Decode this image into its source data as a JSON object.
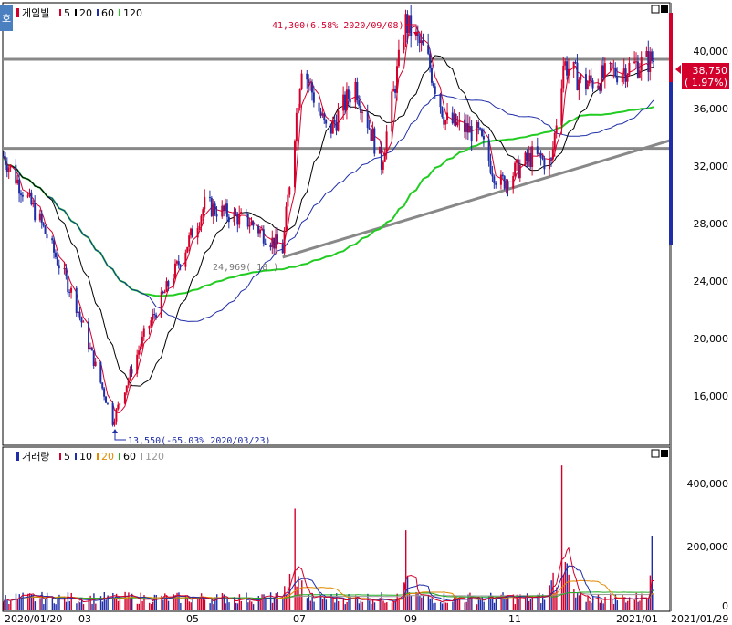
{
  "app": {
    "corner_label": "호",
    "window_buttons": [
      "□",
      "■"
    ]
  },
  "price_panel": {
    "title": "게임빌",
    "legend": [
      {
        "label": "5",
        "color": "#d4002c"
      },
      {
        "label": "20",
        "color": "#000000"
      },
      {
        "label": "60",
        "color": "#1f2ea8"
      },
      {
        "label": "120",
        "color": "#22cc22"
      }
    ],
    "y_ticks": [
      "40,000",
      "36,000",
      "32,000",
      "28,000",
      "24,000",
      "20,000",
      "16,000"
    ],
    "current_price": "38,750",
    "current_change": "( 1.97%)",
    "high_annotation": "41,300(6.58% 2020/09/08)",
    "low_annotation": "13,550(-65.03% 2020/03/23)",
    "mid_annotation": "24,969( 18 )"
  },
  "volume_panel": {
    "title": "거래량",
    "legend": [
      {
        "label": "5",
        "color": "#d4002c"
      },
      {
        "label": "10",
        "color": "#1f2ea8"
      },
      {
        "label": "20",
        "color": "#e08a00"
      },
      {
        "label": "60",
        "color": "#22aa22"
      },
      {
        "label": "120",
        "color": "#999999"
      }
    ],
    "y_ticks": [
      "400,000",
      "200,000",
      "0"
    ]
  },
  "x_axis": {
    "labels": [
      "2020/01/20",
      "03",
      "05",
      "07",
      "09",
      "11",
      "2021/01",
      "2021/01/29"
    ]
  },
  "chart_data": {
    "type": "candlestick",
    "title": "게임빌",
    "price_ylim": [
      12000,
      42500
    ],
    "volume_ylim": [
      0,
      500000
    ],
    "key_points": [
      {
        "date": "2020/01/20",
        "close": 32000
      },
      {
        "date": "2020/02/10",
        "close": 27500
      },
      {
        "date": "2020/03/01",
        "close": 22000
      },
      {
        "date": "2020/03/23",
        "low": 13550
      },
      {
        "date": "2020/04/10",
        "close": 19500
      },
      {
        "date": "2020/05/01",
        "close": 24800
      },
      {
        "date": "2020/05/15",
        "close": 28600
      },
      {
        "date": "2020/06/10",
        "close": 27400
      },
      {
        "date": "2020/06/29",
        "close": 25500
      },
      {
        "date": "2020/07/10",
        "close": 38500
      },
      {
        "date": "2020/07/25",
        "close": 33500
      },
      {
        "date": "2020/08/10",
        "close": 37000
      },
      {
        "date": "2020/08/25",
        "close": 31500
      },
      {
        "date": "2020/09/08",
        "high": 41300
      },
      {
        "date": "2020/09/20",
        "close": 39000
      },
      {
        "date": "2020/10/01",
        "close": 34500
      },
      {
        "date": "2020/10/20",
        "close": 33500
      },
      {
        "date": "2020/11/01",
        "close": 30000
      },
      {
        "date": "2020/11/20",
        "close": 32000
      },
      {
        "date": "2020/12/01",
        "close": 31500
      },
      {
        "date": "2020/12/08",
        "close": 38500
      },
      {
        "date": "2020/12/20",
        "close": 37000
      },
      {
        "date": "2021/01/10",
        "close": 38000
      },
      {
        "date": "2021/01/29",
        "close": 38750
      }
    ],
    "volume_spikes": [
      {
        "date": "2020/07/06",
        "volume": 330000
      },
      {
        "date": "2020/09/08",
        "volume": 260000
      },
      {
        "date": "2020/12/07",
        "volume": 470000
      },
      {
        "date": "2021/01/28",
        "volume": 240000
      }
    ],
    "moving_averages": [
      "5",
      "20",
      "60",
      "120"
    ],
    "volume_moving_averages": [
      "5",
      "10",
      "20",
      "60",
      "120"
    ],
    "horizontal_lines": [
      38750,
      32550
    ]
  }
}
